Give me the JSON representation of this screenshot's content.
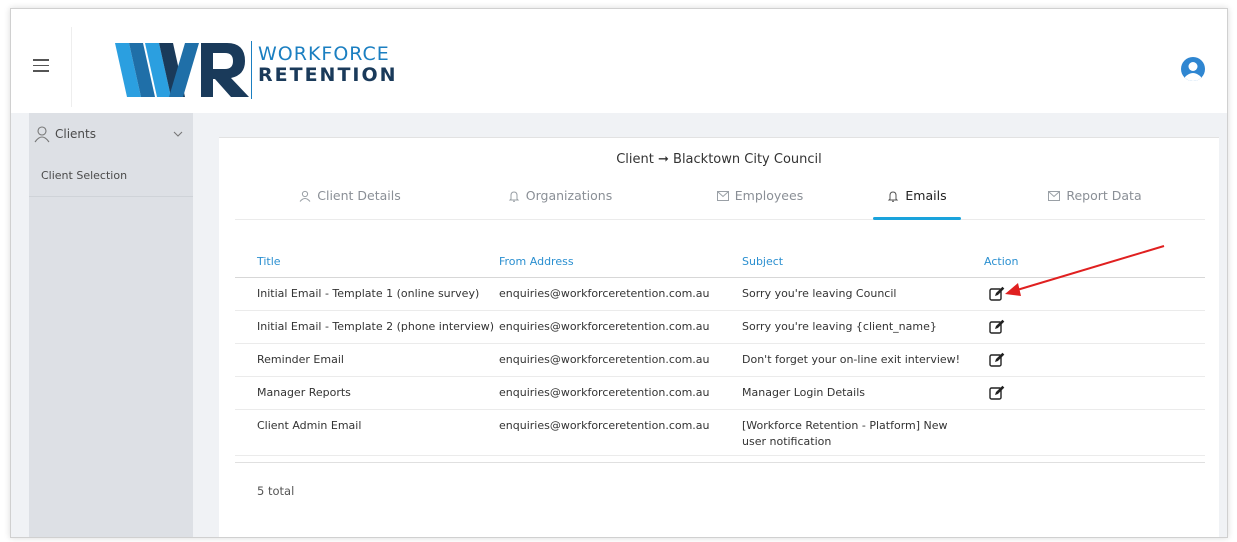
{
  "brand": {
    "line1": "WORKFORCE",
    "line2": "RETENTION",
    "colors": {
      "dark": "#1a3a5a",
      "mid": "#1f6fa8",
      "light": "#2b9fe0"
    }
  },
  "sidebar": {
    "section_label": "Clients",
    "items": [
      {
        "label": "Client Selection"
      }
    ]
  },
  "card": {
    "title": "Client ➞ Blacktown City Council",
    "tabs": [
      {
        "label": "Client Details",
        "icon": "user-icon"
      },
      {
        "label": "Organizations",
        "icon": "bell-icon"
      },
      {
        "label": "Employees",
        "icon": "mail-icon"
      },
      {
        "label": "Emails",
        "icon": "bell-icon",
        "active": true
      },
      {
        "label": "Report Data",
        "icon": "mail-icon"
      }
    ]
  },
  "table": {
    "headers": {
      "title": "Title",
      "from": "From Address",
      "subject": "Subject",
      "action": "Action"
    },
    "rows": [
      {
        "title": "Initial Email - Template 1 (online survey)",
        "from": "enquiries@workforceretention.com.au",
        "subject": "Sorry you're leaving Council",
        "editable": true
      },
      {
        "title": "Initial Email - Template 2 (phone interview)",
        "from": "enquiries@workforceretention.com.au",
        "subject": "Sorry you're leaving {client_name}",
        "editable": true
      },
      {
        "title": "Reminder Email",
        "from": "enquiries@workforceretention.com.au",
        "subject": "Don't forget your on-line exit interview!",
        "editable": true
      },
      {
        "title": "Manager Reports",
        "from": "enquiries@workforceretention.com.au",
        "subject": "Manager Login Details",
        "editable": true
      },
      {
        "title": "Client Admin Email",
        "from": "enquiries@workforceretention.com.au",
        "subject": "[Workforce Retention - Platform] New user notification",
        "editable": false
      }
    ],
    "total": "5 total"
  },
  "annotation": {
    "arrow_color": "#e02020"
  },
  "accent_color": "#1aa3dc",
  "header_text_color": "#2a8fd0"
}
